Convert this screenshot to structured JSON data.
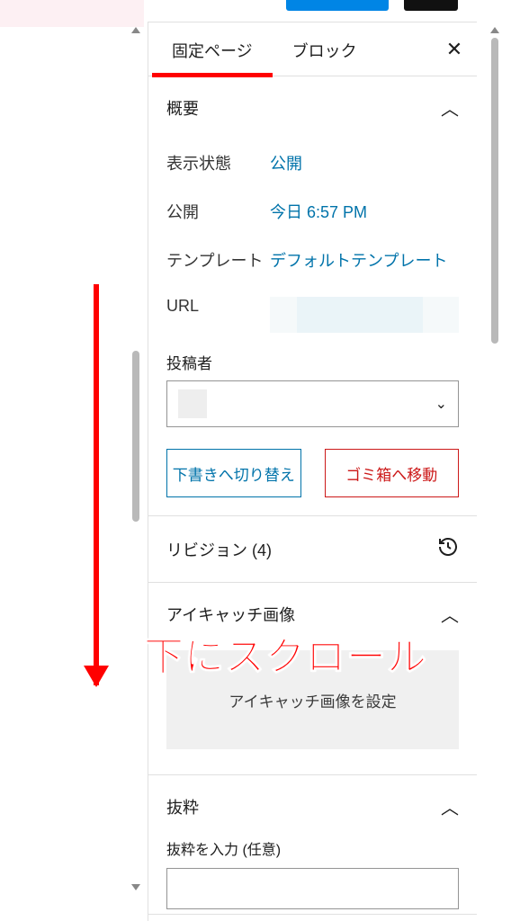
{
  "tabs": {
    "page": "固定ページ",
    "block": "ブロック"
  },
  "overview": {
    "title": "概要",
    "visibility_label": "表示状態",
    "visibility_value": "公開",
    "publish_label": "公開",
    "publish_value": "今日 6:57 PM",
    "template_label": "テンプレート",
    "template_value": "デフォルトテンプレート",
    "url_label": "URL",
    "author_label": "投稿者",
    "switch_draft": "下書きへ切り替え",
    "move_trash": "ゴミ箱へ移動"
  },
  "revision": {
    "label": "リビジョン",
    "count": "(4)"
  },
  "featured": {
    "title": "アイキャッチ画像",
    "placeholder": "アイキャッチ画像を設定"
  },
  "excerpt": {
    "title": "抜粋",
    "label": "抜粋を入力 (任意)"
  },
  "annotation": {
    "text": "下にスクロール"
  }
}
